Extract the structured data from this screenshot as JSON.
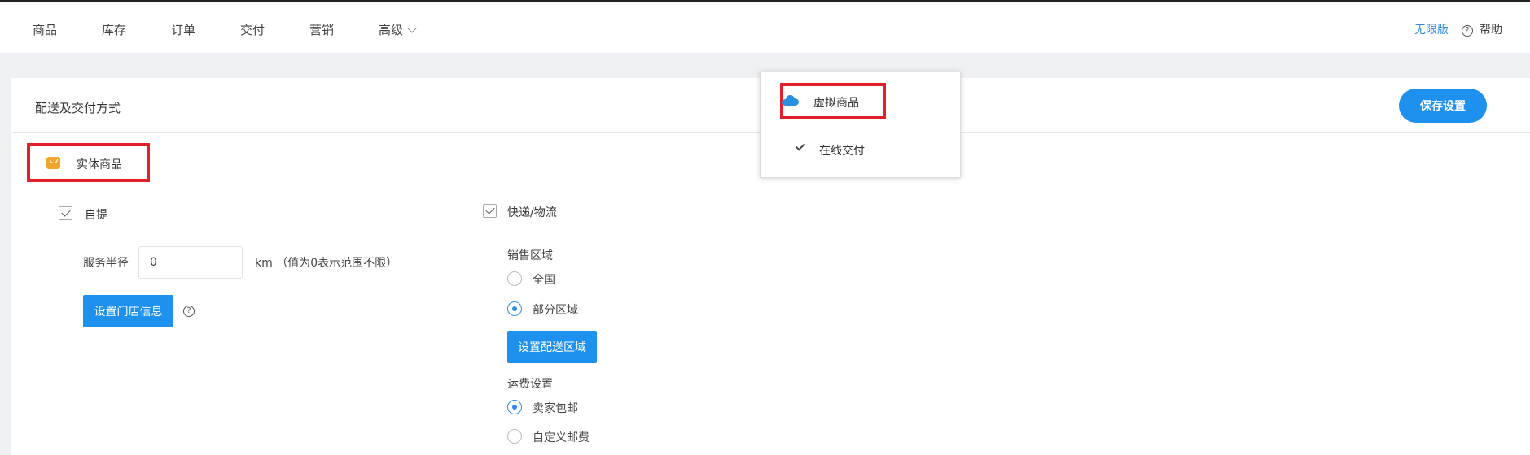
{
  "nav": {
    "items": [
      {
        "label": "商品"
      },
      {
        "label": "库存"
      },
      {
        "label": "订单"
      },
      {
        "label": "交付"
      },
      {
        "label": "营销"
      },
      {
        "label": "高级"
      }
    ],
    "edition": "无限版",
    "help": "帮助"
  },
  "panel": {
    "title": "配送及交付方式",
    "save_label": "保存设置"
  },
  "physical": {
    "title": "实体商品",
    "pickup": {
      "label": "自提",
      "checked": true,
      "radius_label": "服务半径",
      "radius_value": "0",
      "radius_unit": "km （值为0表示范围不限）",
      "store_button": "设置门店信息"
    },
    "express": {
      "label": "快递/物流",
      "checked": true,
      "region_title": "销售区域",
      "region_options": [
        {
          "label": "全国",
          "selected": false
        },
        {
          "label": "部分区域",
          "selected": true
        }
      ],
      "region_button": "设置配送区域",
      "fee_title": "运费设置",
      "fee_options": [
        {
          "label": "卖家包邮",
          "selected": true
        },
        {
          "label": "自定义邮费",
          "selected": false
        }
      ]
    }
  },
  "virtual": {
    "title": "虚拟商品",
    "online_delivery": "在线交付"
  },
  "colors": {
    "accent": "#1e90ee",
    "highlight": "#e3202a",
    "bag_icon": "#f2a52b"
  }
}
